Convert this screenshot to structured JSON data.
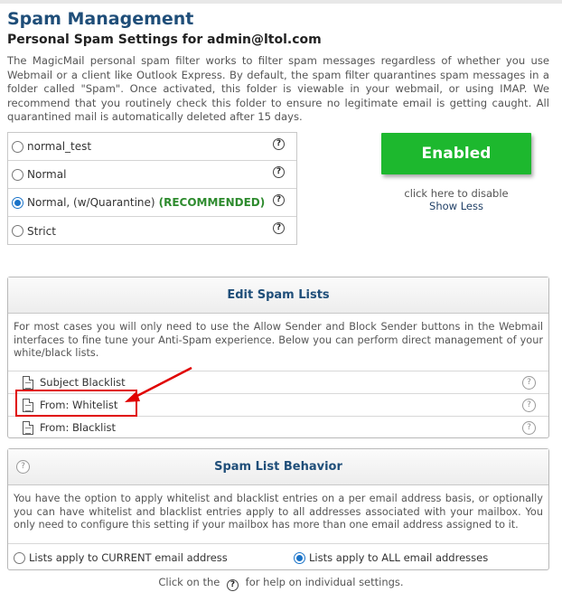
{
  "header": {
    "title": "Spam Management",
    "subtitle": "Personal Spam Settings for admin@ltol.com"
  },
  "intro_text": "The MagicMail personal spam filter works to filter spam messages regardless of whether you use Webmail or a client like Outlook Express. By default, the spam filter quarantines spam messages in a folder called \"Spam\". Once activated, this folder is viewable in your webmail, or using IMAP. We recommend that you routinely check this folder to ensure no legitimate email is getting caught. All quarantined mail is automatically deleted after 15 days.",
  "filter_levels": [
    {
      "label": "normal_test",
      "checked": false
    },
    {
      "label": "Normal",
      "checked": false
    },
    {
      "label": "Normal, (w/Quarantine)",
      "badge": "(RECOMMENDED)",
      "checked": true
    },
    {
      "label": "Strict",
      "checked": false
    }
  ],
  "help_glyph": "?",
  "status": {
    "button_label": "Enabled",
    "hint": "click here to disable",
    "toggle_details": "Show Less",
    "button_color": "#1db82e"
  },
  "spam_lists": {
    "title": "Edit Spam Lists",
    "description": "For most cases you will only need to use the Allow Sender and Block Sender buttons in the Webmail interfaces to fine tune your Anti-Spam experience. Below you can perform direct management of your white/black lists.",
    "items": [
      {
        "label": "Subject Blacklist"
      },
      {
        "label": "From: Whitelist"
      },
      {
        "label": "From: Blacklist"
      }
    ]
  },
  "behavior": {
    "title": "Spam List Behavior",
    "description": "You have the option to apply whitelist and blacklist entries on a per email address basis, or optionally you can have whitelist and blacklist entries apply to all addresses associated with your mailbox. You only need to configure this setting if your mailbox has more than one email address assigned to it.",
    "options": [
      {
        "label": "Lists apply to CURRENT email address",
        "checked": false
      },
      {
        "label": "Lists apply to ALL email addresses",
        "checked": true
      }
    ]
  },
  "footer": {
    "before": "Click on the",
    "after": "for help on individual settings."
  },
  "colors": {
    "title": "#1f4e79",
    "recommended": "#2e8b2e",
    "annotation": "#e00000",
    "radio_selected": "#1a73c8"
  }
}
